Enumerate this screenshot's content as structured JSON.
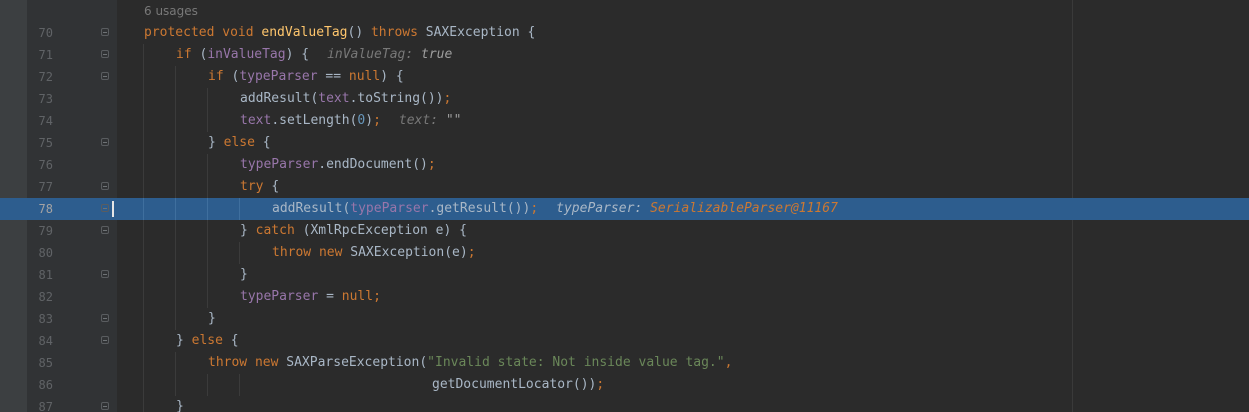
{
  "editor": {
    "usages_label": "6 usages",
    "current_line": 78,
    "lines": [
      {
        "num": "70",
        "indent": 0,
        "fold": true,
        "tokens": [
          {
            "t": "protected void ",
            "c": "kw"
          },
          {
            "t": "endValueTag",
            "c": "m"
          },
          {
            "t": "() ",
            "c": "p"
          },
          {
            "t": "throws ",
            "c": "kw"
          },
          {
            "t": "SAXException {",
            "c": "p"
          }
        ]
      },
      {
        "num": "71",
        "indent": 1,
        "fold": true,
        "tokens": [
          {
            "t": "if ",
            "c": "kw"
          },
          {
            "t": "(",
            "c": "p"
          },
          {
            "t": "inValueTag",
            "c": "f"
          },
          {
            "t": ") {",
            "c": "p"
          }
        ],
        "hint": {
          "name": "inValueTag:",
          "value": "true",
          "obj": false
        }
      },
      {
        "num": "72",
        "indent": 2,
        "fold": true,
        "tokens": [
          {
            "t": "if ",
            "c": "kw"
          },
          {
            "t": "(",
            "c": "p"
          },
          {
            "t": "typeParser",
            "c": "f"
          },
          {
            "t": " == ",
            "c": "p"
          },
          {
            "t": "null",
            "c": "kw"
          },
          {
            "t": ") {",
            "c": "p"
          }
        ]
      },
      {
        "num": "73",
        "indent": 3,
        "fold": false,
        "tokens": [
          {
            "t": "addResult(",
            "c": "p"
          },
          {
            "t": "text",
            "c": "f"
          },
          {
            "t": ".toString())",
            "c": "p"
          },
          {
            "t": ";",
            "c": "kw"
          }
        ]
      },
      {
        "num": "74",
        "indent": 3,
        "fold": false,
        "tokens": [
          {
            "t": "text",
            "c": "f"
          },
          {
            "t": ".setLength(",
            "c": "p"
          },
          {
            "t": "0",
            "c": "n"
          },
          {
            "t": ")",
            "c": "p"
          },
          {
            "t": ";",
            "c": "kw"
          }
        ],
        "hint": {
          "name": "text:",
          "value": "\"\"",
          "obj": false
        }
      },
      {
        "num": "75",
        "indent": 2,
        "fold": true,
        "tokens": [
          {
            "t": "} ",
            "c": "p"
          },
          {
            "t": "else ",
            "c": "kw"
          },
          {
            "t": "{",
            "c": "p"
          }
        ]
      },
      {
        "num": "76",
        "indent": 3,
        "fold": false,
        "tokens": [
          {
            "t": "typeParser",
            "c": "f"
          },
          {
            "t": ".endDocument()",
            "c": "p"
          },
          {
            "t": ";",
            "c": "kw"
          }
        ]
      },
      {
        "num": "77",
        "indent": 3,
        "fold": true,
        "tokens": [
          {
            "t": "try ",
            "c": "kw"
          },
          {
            "t": "{",
            "c": "p"
          }
        ]
      },
      {
        "num": "78",
        "indent": 4,
        "fold": true,
        "tokens": [
          {
            "t": "addResult(",
            "c": "p"
          },
          {
            "t": "typeParser",
            "c": "f"
          },
          {
            "t": ".getResult())",
            "c": "p"
          },
          {
            "t": ";",
            "c": "kw"
          }
        ],
        "hint": {
          "name": "typeParser:",
          "value": "SerializableParser@11167",
          "obj": true
        }
      },
      {
        "num": "79",
        "indent": 3,
        "fold": true,
        "tokens": [
          {
            "t": "} ",
            "c": "p"
          },
          {
            "t": "catch ",
            "c": "kw"
          },
          {
            "t": "(XmlRpcException e) {",
            "c": "p"
          }
        ]
      },
      {
        "num": "80",
        "indent": 4,
        "fold": false,
        "tokens": [
          {
            "t": "throw new ",
            "c": "kw"
          },
          {
            "t": "SAXException(e)",
            "c": "p"
          },
          {
            "t": ";",
            "c": "kw"
          }
        ]
      },
      {
        "num": "81",
        "indent": 3,
        "fold": true,
        "tokens": [
          {
            "t": "}",
            "c": "p"
          }
        ]
      },
      {
        "num": "82",
        "indent": 3,
        "fold": false,
        "tokens": [
          {
            "t": "typeParser",
            "c": "f"
          },
          {
            "t": " = ",
            "c": "p"
          },
          {
            "t": "null",
            "c": "kw"
          },
          {
            "t": ";",
            "c": "kw"
          }
        ]
      },
      {
        "num": "83",
        "indent": 2,
        "fold": true,
        "tokens": [
          {
            "t": "}",
            "c": "p"
          }
        ]
      },
      {
        "num": "84",
        "indent": 1,
        "fold": true,
        "tokens": [
          {
            "t": "} ",
            "c": "p"
          },
          {
            "t": "else ",
            "c": "kw"
          },
          {
            "t": "{",
            "c": "p"
          }
        ]
      },
      {
        "num": "85",
        "indent": 2,
        "fold": false,
        "tokens": [
          {
            "t": "throw new ",
            "c": "kw"
          },
          {
            "t": "SAXParseException(",
            "c": "p"
          },
          {
            "t": "\"Invalid state: Not inside value tag.\"",
            "c": "s"
          },
          {
            "t": ",",
            "c": "kw"
          }
        ]
      },
      {
        "num": "86",
        "indent": 9,
        "fold": false,
        "tokens": [
          {
            "t": "getDocumentLocator())",
            "c": "p"
          },
          {
            "t": ";",
            "c": "kw"
          }
        ]
      },
      {
        "num": "87",
        "indent": 1,
        "fold": true,
        "tokens": [
          {
            "t": "}",
            "c": "p"
          }
        ]
      }
    ]
  }
}
